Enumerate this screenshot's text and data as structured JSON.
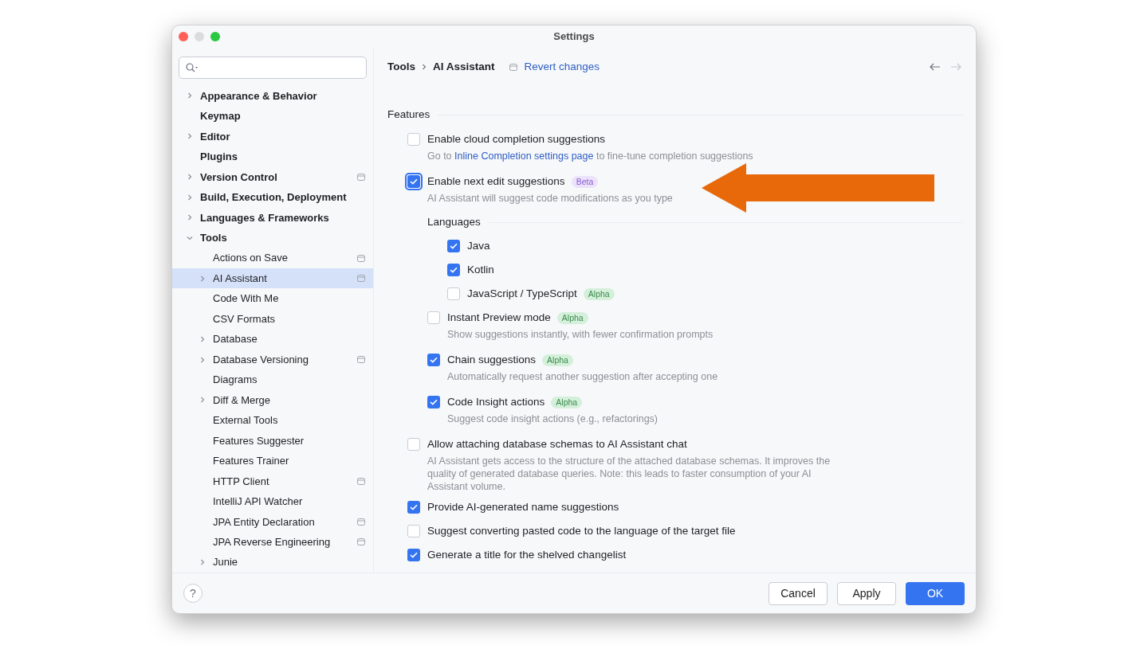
{
  "window": {
    "title": "Settings",
    "traffic_lights": [
      {
        "kind": "close",
        "disabled": false
      },
      {
        "kind": "minimize",
        "disabled": true
      },
      {
        "kind": "zoom",
        "disabled": false
      }
    ]
  },
  "sidebar": {
    "items": [
      {
        "label": "Appearance & Behavior",
        "kind": "group",
        "expanded": false,
        "selected": false,
        "project_scoped": false
      },
      {
        "label": "Keymap",
        "kind": "leaf",
        "selected": false,
        "project_scoped": false
      },
      {
        "label": "Editor",
        "kind": "group",
        "expanded": false,
        "selected": false,
        "project_scoped": false
      },
      {
        "label": "Plugins",
        "kind": "leaf",
        "selected": false,
        "project_scoped": false
      },
      {
        "label": "Version Control",
        "kind": "group",
        "expanded": false,
        "selected": false,
        "project_scoped": true
      },
      {
        "label": "Build, Execution, Deployment",
        "kind": "group",
        "expanded": false,
        "selected": false,
        "project_scoped": false
      },
      {
        "label": "Languages & Frameworks",
        "kind": "group",
        "expanded": false,
        "selected": false,
        "project_scoped": false
      },
      {
        "label": "Tools",
        "kind": "group",
        "expanded": true,
        "selected": false,
        "project_scoped": false,
        "children": [
          {
            "label": "Actions on Save",
            "kind": "leaf",
            "selected": false,
            "project_scoped": true
          },
          {
            "label": "AI Assistant",
            "kind": "group",
            "expanded": false,
            "selected": true,
            "project_scoped": true
          },
          {
            "label": "Code With Me",
            "kind": "leaf",
            "selected": false,
            "project_scoped": false
          },
          {
            "label": "CSV Formats",
            "kind": "leaf",
            "selected": false,
            "project_scoped": false
          },
          {
            "label": "Database",
            "kind": "group",
            "expanded": false,
            "selected": false,
            "project_scoped": false
          },
          {
            "label": "Database Versioning",
            "kind": "group",
            "expanded": false,
            "selected": false,
            "project_scoped": true
          },
          {
            "label": "Diagrams",
            "kind": "leaf",
            "selected": false,
            "project_scoped": false
          },
          {
            "label": "Diff & Merge",
            "kind": "group",
            "expanded": false,
            "selected": false,
            "project_scoped": false
          },
          {
            "label": "External Tools",
            "kind": "leaf",
            "selected": false,
            "project_scoped": false
          },
          {
            "label": "Features Suggester",
            "kind": "leaf",
            "selected": false,
            "project_scoped": false
          },
          {
            "label": "Features Trainer",
            "kind": "leaf",
            "selected": false,
            "project_scoped": false
          },
          {
            "label": "HTTP Client",
            "kind": "leaf",
            "selected": false,
            "project_scoped": true
          },
          {
            "label": "IntelliJ API Watcher",
            "kind": "leaf",
            "selected": false,
            "project_scoped": false
          },
          {
            "label": "JPA Entity Declaration",
            "kind": "leaf",
            "selected": false,
            "project_scoped": true
          },
          {
            "label": "JPA Reverse Engineering",
            "kind": "leaf",
            "selected": false,
            "project_scoped": true
          },
          {
            "label": "Junie",
            "kind": "group",
            "expanded": false,
            "selected": false,
            "project_scoped": false
          }
        ]
      }
    ]
  },
  "header": {
    "breadcrumb": [
      "Tools",
      "AI Assistant"
    ],
    "revert": "Revert changes",
    "nav": [
      {
        "kind": "back",
        "disabled": false
      },
      {
        "kind": "forward",
        "disabled": true
      }
    ]
  },
  "features": {
    "title": "Features",
    "options": [
      {
        "label": "Enable cloud completion suggestions",
        "checked": false,
        "focused": false,
        "hint": [
          {
            "kind": "text",
            "text": "Go to"
          },
          {
            "kind": "link",
            "text": "Inline Completion settings page"
          },
          {
            "kind": "text",
            "text": "to fine-tune completion suggestions"
          }
        ]
      },
      {
        "label": "Enable next edit suggestions",
        "checked": true,
        "focused": true,
        "badge": {
          "text": "Beta",
          "kind": "beta"
        },
        "hint": [
          {
            "kind": "text",
            "text": "AI Assistant will suggest code modifications as you type"
          }
        ],
        "group": {
          "title": "Languages",
          "options": [
            {
              "label": "Java",
              "checked": true,
              "focused": false
            },
            {
              "label": "Kotlin",
              "checked": true,
              "focused": false
            },
            {
              "label": "JavaScript / TypeScript",
              "checked": false,
              "focused": false,
              "badge": {
                "text": "Alpha",
                "kind": "alpha"
              }
            }
          ]
        },
        "children": [
          {
            "label": "Instant Preview mode",
            "checked": false,
            "focused": false,
            "badge": {
              "text": "Alpha",
              "kind": "alpha"
            },
            "hint": [
              {
                "kind": "text",
                "text": "Show suggestions instantly, with fewer confirmation prompts"
              }
            ]
          },
          {
            "label": "Chain suggestions",
            "checked": true,
            "focused": false,
            "badge": {
              "text": "Alpha",
              "kind": "alpha"
            },
            "hint": [
              {
                "kind": "text",
                "text": "Automatically request another suggestion after accepting one"
              }
            ]
          },
          {
            "label": "Code Insight actions",
            "checked": true,
            "focused": false,
            "badge": {
              "text": "Alpha",
              "kind": "alpha"
            },
            "hint": [
              {
                "kind": "text",
                "text": "Suggest code insight actions (e.g., refactorings)"
              }
            ]
          }
        ]
      },
      {
        "label": "Allow attaching database schemas to AI Assistant chat",
        "checked": false,
        "focused": false,
        "hint": [
          {
            "kind": "text",
            "text": "AI Assistant gets access to the structure of the attached database schemas. It improves the quality of generated database queries. Note: this leads to faster consumption of your AI Assistant volume."
          }
        ]
      },
      {
        "label": "Provide AI-generated name suggestions",
        "checked": true,
        "focused": false
      },
      {
        "label": "Suggest converting pasted code to the language of the target file",
        "checked": false,
        "focused": false
      },
      {
        "label": "Generate a title for the shelved changelist",
        "checked": true,
        "focused": false
      }
    ]
  },
  "footer": {
    "help": "?",
    "buttons": [
      {
        "label": "Cancel",
        "primary": false
      },
      {
        "label": "Apply",
        "primary": false
      },
      {
        "label": "OK",
        "primary": true
      }
    ]
  },
  "annotation": {
    "kind": "arrow"
  }
}
